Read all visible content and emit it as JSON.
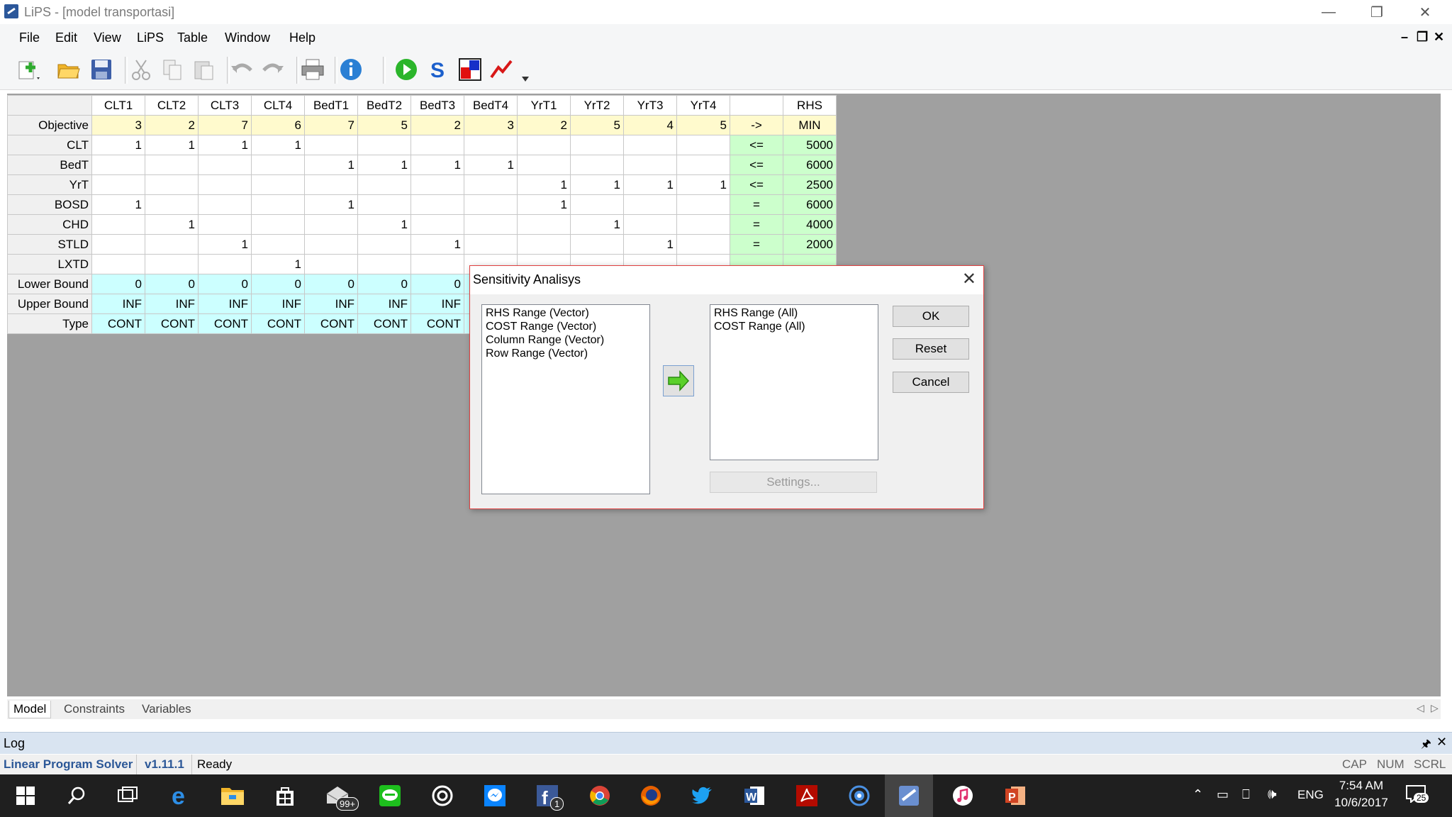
{
  "window": {
    "title": "LiPS - [model transportasi]"
  },
  "menu": [
    "File",
    "Edit",
    "View",
    "LiPS",
    "Table",
    "Window",
    "Help"
  ],
  "grid": {
    "columns": [
      "CLT1",
      "CLT2",
      "CLT3",
      "CLT4",
      "BedT1",
      "BedT2",
      "BedT3",
      "BedT4",
      "YrT1",
      "YrT2",
      "YrT3",
      "YrT4",
      "",
      "RHS"
    ],
    "rows": [
      {
        "label": "Objective",
        "cells": [
          "3",
          "2",
          "7",
          "6",
          "7",
          "5",
          "2",
          "3",
          "2",
          "5",
          "4",
          "5",
          "->",
          "MIN"
        ]
      },
      {
        "label": "CLT",
        "cells": [
          "1",
          "1",
          "1",
          "1",
          "",
          "",
          "",
          "",
          "",
          "",
          "",
          "",
          "<=",
          "5000"
        ]
      },
      {
        "label": "BedT",
        "cells": [
          "",
          "",
          "",
          "",
          "1",
          "1",
          "1",
          "1",
          "",
          "",
          "",
          "",
          "<=",
          "6000"
        ]
      },
      {
        "label": "YrT",
        "cells": [
          "",
          "",
          "",
          "",
          "",
          "",
          "",
          "",
          "1",
          "1",
          "1",
          "1",
          "<=",
          "2500"
        ]
      },
      {
        "label": "BOSD",
        "cells": [
          "1",
          "",
          "",
          "",
          "1",
          "",
          "",
          "",
          "1",
          "",
          "",
          "",
          "=",
          "6000"
        ]
      },
      {
        "label": "CHD",
        "cells": [
          "",
          "1",
          "",
          "",
          "",
          "1",
          "",
          "",
          "",
          "1",
          "",
          "",
          "=",
          "4000"
        ]
      },
      {
        "label": "STLD",
        "cells": [
          "",
          "",
          "1",
          "",
          "",
          "",
          "1",
          "",
          "",
          "",
          "1",
          "",
          "=",
          "2000"
        ]
      },
      {
        "label": "LXTD",
        "cells": [
          "",
          "",
          "",
          "1",
          "",
          "",
          "",
          "",
          "",
          "",
          "",
          "",
          "",
          ""
        ]
      },
      {
        "label": "Lower Bound",
        "cells": [
          "0",
          "0",
          "0",
          "0",
          "0",
          "0",
          "0",
          "",
          "",
          "",
          "",
          "",
          "",
          ""
        ]
      },
      {
        "label": "Upper Bound",
        "cells": [
          "INF",
          "INF",
          "INF",
          "INF",
          "INF",
          "INF",
          "INF",
          "",
          "",
          "",
          "",
          "",
          "",
          ""
        ]
      },
      {
        "label": "Type",
        "cells": [
          "CONT",
          "CONT",
          "CONT",
          "CONT",
          "CONT",
          "CONT",
          "CONT",
          "",
          "",
          "",
          "",
          "",
          "",
          ""
        ]
      }
    ]
  },
  "dialog": {
    "title": "Sensitivity Analisys",
    "available": [
      "RHS Range (Vector)",
      "COST Range (Vector)",
      "Column Range (Vector)",
      "Row Range (Vector)"
    ],
    "selected": [
      "RHS Range (All)",
      "COST Range (All)"
    ],
    "ok_label": "OK",
    "reset_label": "Reset",
    "cancel_label": "Cancel",
    "settings_label": "Settings..."
  },
  "tabs": [
    "Model",
    "Constraints",
    "Variables"
  ],
  "log": {
    "title": "Log"
  },
  "status": {
    "app": "Linear Program Solver",
    "version": "v1.11.1",
    "state": "Ready",
    "cap": "CAP",
    "num": "NUM",
    "scrl": "SCRL"
  },
  "taskbar": {
    "lang": "ENG",
    "time": "7:54 AM",
    "date": "10/6/2017",
    "mail_badge": "99+",
    "fb_badge": "1",
    "notif_count": "25"
  },
  "colors": {
    "objective_row": "#fffacd",
    "rhs_column": "#ccffcc",
    "bounds_rows": "#ccffff",
    "dialog_border": "#e04040",
    "taskbar": "#1f1f1f"
  }
}
